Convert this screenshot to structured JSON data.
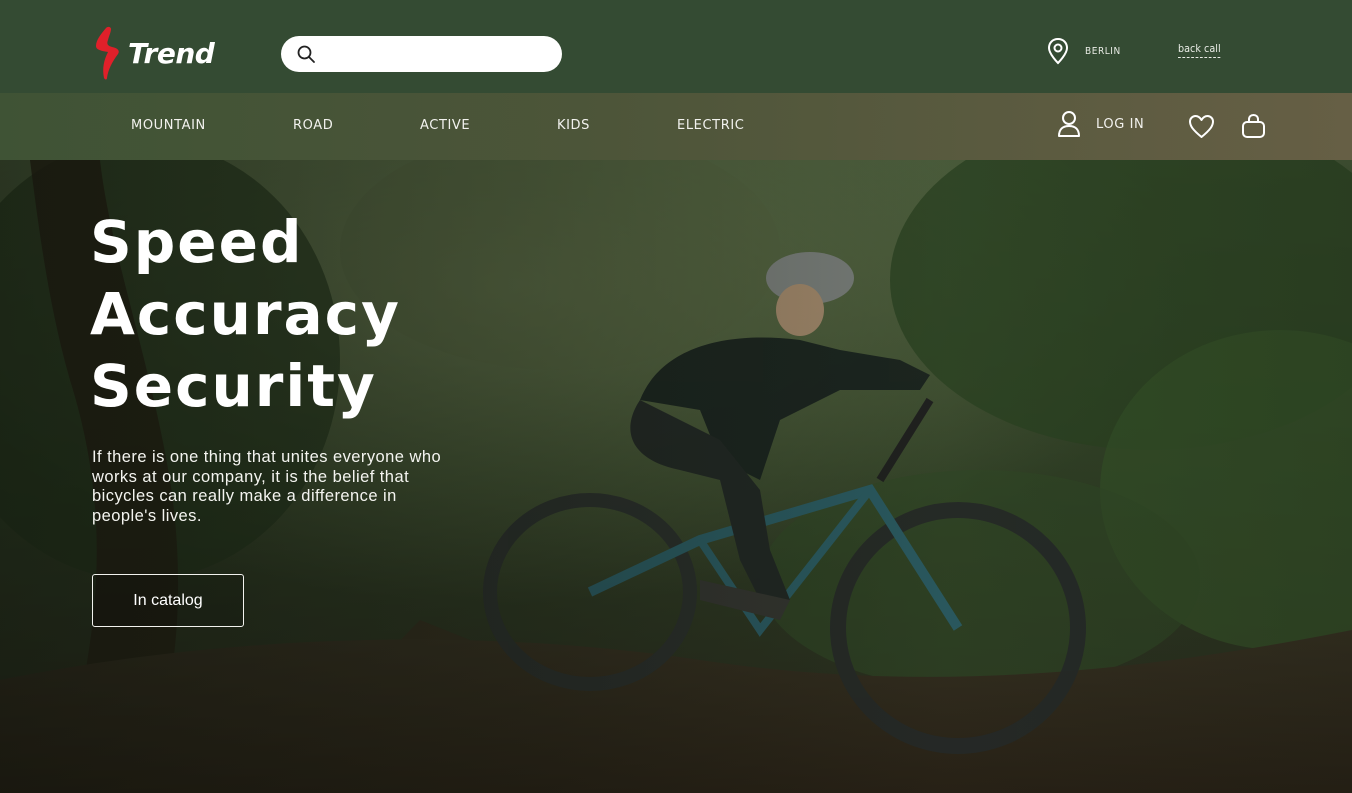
{
  "brand": {
    "name": "Trend",
    "logo_color": "#e0202a"
  },
  "search": {
    "placeholder": "",
    "value": "",
    "icon": "search-icon"
  },
  "header": {
    "city": "BERLIN",
    "back_call": "back call",
    "location_icon": "map-pin-icon"
  },
  "nav": {
    "items": [
      {
        "label": "MOUNTAIN"
      },
      {
        "label": "ROAD"
      },
      {
        "label": "ACTIVE"
      },
      {
        "label": "KIDS"
      },
      {
        "label": "ELECTRIC"
      }
    ],
    "login_label": "LOG IN",
    "icons": [
      "user-icon",
      "heart-icon",
      "shopping-bag-icon"
    ]
  },
  "hero": {
    "headline": [
      "Speed",
      "Accuracy",
      "Security"
    ],
    "lead": "If there is one thing that unites everyone who works at our company, it is the belief that bicycles can really make a difference in people's lives.",
    "cta_label": "In catalog",
    "image": "mountain-biker-riding-forest-trail"
  },
  "colors": {
    "topbar": "#344b33",
    "navbar_start": "#3f5335",
    "navbar_end": "#665f45",
    "text": "#ffffff"
  }
}
